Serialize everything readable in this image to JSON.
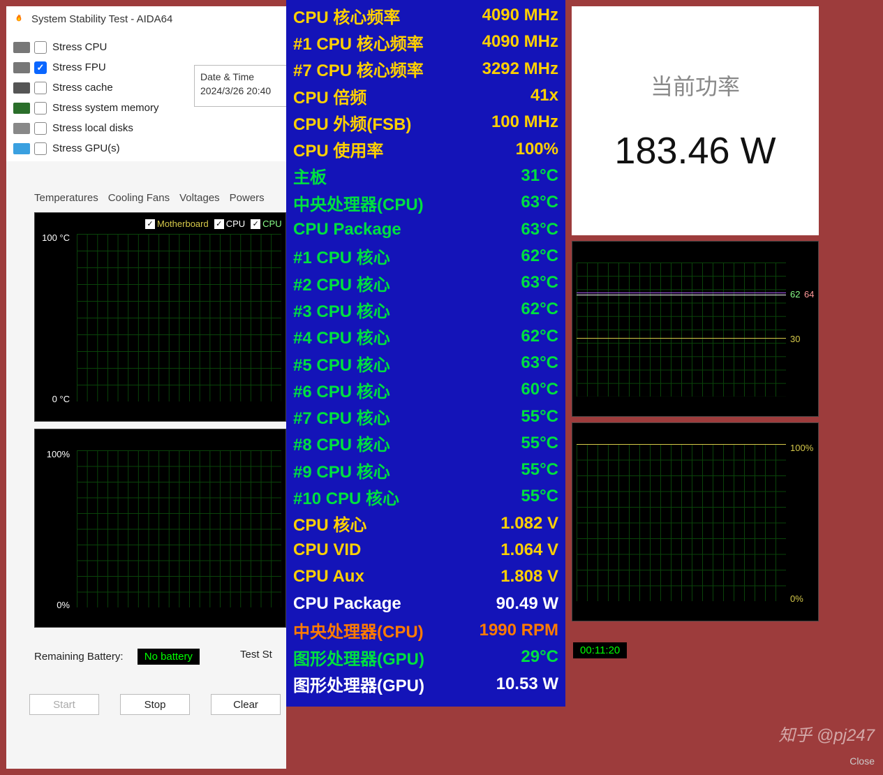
{
  "window": {
    "title": "System Stability Test - AIDA64"
  },
  "stress_options": [
    {
      "label": "Stress CPU",
      "checked": false
    },
    {
      "label": "Stress FPU",
      "checked": true
    },
    {
      "label": "Stress cache",
      "checked": false
    },
    {
      "label": "Stress system memory",
      "checked": false
    },
    {
      "label": "Stress local disks",
      "checked": false
    },
    {
      "label": "Stress GPU(s)",
      "checked": false
    }
  ],
  "datetime": {
    "label": "Date & Time",
    "value": "2024/3/26 20:40"
  },
  "tabs": [
    "Temperatures",
    "Cooling Fans",
    "Voltages",
    "Powers"
  ],
  "graph1": {
    "checks": [
      {
        "label": "Motherboard",
        "color": "#d6c94a"
      },
      {
        "label": "CPU",
        "color": "#fff"
      },
      {
        "label": "CPU",
        "color": "#8f8"
      }
    ],
    "y_top": "100 °C",
    "y_bot": "0 °C"
  },
  "graph2": {
    "y_top": "100%",
    "y_bot": "0%"
  },
  "graph3": {
    "v1": "62",
    "v2": "64",
    "v3": "30"
  },
  "graph4": {
    "y_top": "100%",
    "y_bot": "0%"
  },
  "remaining": {
    "label": "Remaining Battery:",
    "value": "No battery"
  },
  "test_status_label": "Test St",
  "elapsed": "00:11:20",
  "buttons": {
    "start": "Start",
    "stop": "Stop",
    "clear": "Clear",
    "close": "Close"
  },
  "center_rows": [
    {
      "k": "CPU 核心频率",
      "v": "4090 MHz",
      "c": "#ffd000"
    },
    {
      "k": "#1 CPU 核心频率",
      "v": "4090 MHz",
      "c": "#ffd000"
    },
    {
      "k": "#7 CPU 核心频率",
      "v": "3292 MHz",
      "c": "#ffd000"
    },
    {
      "k": "CPU 倍频",
      "v": "41x",
      "c": "#ffd000"
    },
    {
      "k": "CPU 外频(FSB)",
      "v": "100 MHz",
      "c": "#ffd000"
    },
    {
      "k": "CPU 使用率",
      "v": "100%",
      "c": "#ffd000"
    },
    {
      "k": "主板",
      "v": "31°C",
      "c": "#00e040"
    },
    {
      "k": "中央处理器(CPU)",
      "v": "63°C",
      "c": "#00e040"
    },
    {
      "k": "CPU Package",
      "v": "63°C",
      "c": "#00e040"
    },
    {
      "k": "#1 CPU 核心",
      "v": "62°C",
      "c": "#00e040"
    },
    {
      "k": "#2 CPU 核心",
      "v": "63°C",
      "c": "#00e040"
    },
    {
      "k": "#3 CPU 核心",
      "v": "62°C",
      "c": "#00e040"
    },
    {
      "k": "#4 CPU 核心",
      "v": "62°C",
      "c": "#00e040"
    },
    {
      "k": "#5 CPU 核心",
      "v": "63°C",
      "c": "#00e040"
    },
    {
      "k": "#6 CPU 核心",
      "v": "60°C",
      "c": "#00e040"
    },
    {
      "k": "#7 CPU 核心",
      "v": "55°C",
      "c": "#00e040"
    },
    {
      "k": "#8 CPU 核心",
      "v": "55°C",
      "c": "#00e040"
    },
    {
      "k": "#9 CPU 核心",
      "v": "55°C",
      "c": "#00e040"
    },
    {
      "k": "#10 CPU 核心",
      "v": "55°C",
      "c": "#00e040"
    },
    {
      "k": "CPU 核心",
      "v": "1.082 V",
      "c": "#ffd000"
    },
    {
      "k": "CPU VID",
      "v": "1.064 V",
      "c": "#ffd000"
    },
    {
      "k": "CPU Aux",
      "v": "1.808 V",
      "c": "#ffd000"
    },
    {
      "k": "CPU Package",
      "v": "90.49 W",
      "c": "#ffffff"
    },
    {
      "k": "中央处理器(CPU)",
      "v": "1990 RPM",
      "c": "#ff7b00"
    },
    {
      "k": "图形处理器(GPU)",
      "v": "29°C",
      "c": "#00e040"
    },
    {
      "k": "图形处理器(GPU)",
      "v": "10.53 W",
      "c": "#ffffff"
    }
  ],
  "power": {
    "label": "当前功率",
    "value": "183.46 W"
  },
  "watermark": "知乎 @pj247",
  "chart_data": [
    {
      "type": "line",
      "title": "Temperatures",
      "ylabel": "°C",
      "ylim": [
        0,
        100
      ],
      "series": [
        {
          "name": "Motherboard"
        },
        {
          "name": "CPU"
        },
        {
          "name": "CPU"
        }
      ]
    },
    {
      "type": "line",
      "title": "Usage",
      "ylabel": "%",
      "ylim": [
        0,
        100
      ]
    },
    {
      "type": "line",
      "title": "Temps right",
      "series": [
        {
          "name": "purple",
          "approx": 62
        },
        {
          "name": "white",
          "approx": 64
        },
        {
          "name": "yellow",
          "approx": 30
        }
      ]
    },
    {
      "type": "line",
      "title": "Usage right",
      "ylabel": "%",
      "ylim": [
        0,
        100
      ],
      "series": [
        {
          "name": "usage",
          "approx": 100
        }
      ]
    }
  ]
}
